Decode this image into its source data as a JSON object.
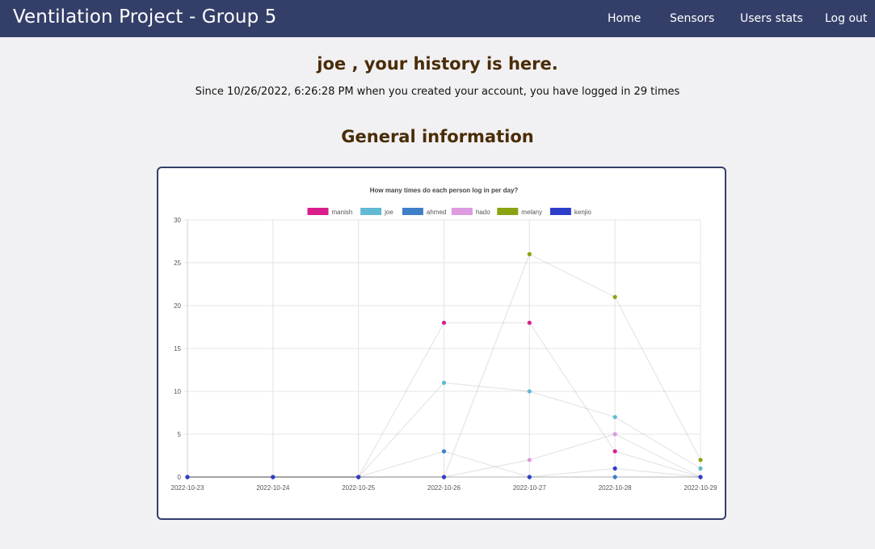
{
  "nav": {
    "brand": "Ventilation Project - Group 5",
    "links": [
      "Home",
      "Sensors",
      "Users stats",
      "Log out"
    ]
  },
  "main": {
    "history_heading": "joe , your history is here.",
    "since_text": "Since 10/26/2022, 6:26:28 PM when you created your account, you have logged in 29 times",
    "general_heading": "General information"
  },
  "colors": {
    "navbar": "#343f69",
    "heading": "#4a2c06",
    "card_border": "#343f69"
  },
  "chart_data": {
    "type": "line",
    "title": "How many times do each person log in per day?",
    "xlabel": "",
    "ylabel": "",
    "categories": [
      "2022-10-23",
      "2022-10-24",
      "2022-10-25",
      "2022-10-26",
      "2022-10-27",
      "2022-10-28",
      "2022-10-29"
    ],
    "ylim": [
      0,
      30
    ],
    "yticks": [
      0,
      5,
      10,
      15,
      20,
      25,
      30
    ],
    "grid": true,
    "legend_position": "top",
    "series": [
      {
        "name": "manish",
        "color": "#d91e8c",
        "values": [
          0,
          0,
          0,
          18,
          18,
          3,
          0
        ]
      },
      {
        "name": "joe",
        "color": "#62b9d4",
        "values": [
          0,
          0,
          0,
          11,
          10,
          7,
          1
        ]
      },
      {
        "name": "ahmed",
        "color": "#3e7fc7",
        "values": [
          0,
          0,
          0,
          3,
          0,
          0,
          0
        ]
      },
      {
        "name": "hado",
        "color": "#dd9be0",
        "values": [
          0,
          0,
          0,
          0,
          2,
          5,
          0
        ]
      },
      {
        "name": "melany",
        "color": "#8aa313",
        "values": [
          0,
          0,
          0,
          0,
          26,
          21,
          2
        ]
      },
      {
        "name": "kenjio",
        "color": "#2f3ec9",
        "values": [
          0,
          0,
          0,
          0,
          0,
          1,
          0
        ]
      }
    ]
  }
}
